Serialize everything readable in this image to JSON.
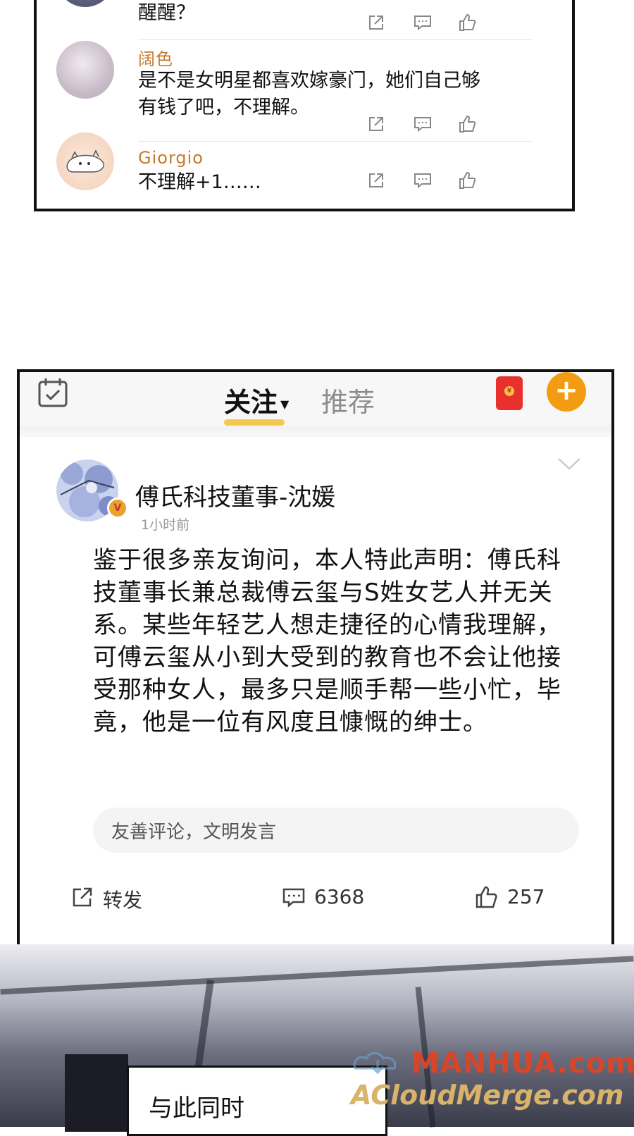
{
  "top_comments": [
    {
      "username": "",
      "text": "醒醒？"
    },
    {
      "username": "阔色",
      "text": "是不是女明星都喜欢嫁豪门，她们自己够有钱了吧，不理解。"
    },
    {
      "username": "Giorgio",
      "text": "不理解+1……"
    }
  ],
  "feed": {
    "tabs": {
      "follow": "关注",
      "recommend": "推荐"
    },
    "post": {
      "author": "傅氏科技董事-沈媛",
      "verified_badge": "V",
      "time": "1小时前",
      "body": "鉴于很多亲友询问，本人特此声明：傅氏科技董事长兼总裁傅云玺与S姓女艺人并无关系。某些年轻艺人想走捷径的心情我理解，可傅云玺从小到大受到的教育也不会让他接受那种女人，最多只是顺手帮一些小忙，毕竟，他是一位有风度且慷慨的绅士。",
      "comment_placeholder": "友善评论，文明发言",
      "actions": {
        "repost": "转发",
        "comments": "6368",
        "likes": "257"
      }
    }
  },
  "scene": {
    "narration": "与此同时",
    "watermark_line1": "MANHUA.com",
    "watermark_line2": "ACloudMerge.com"
  },
  "colors": {
    "username": "#c47a2a",
    "tab_underline": "#f2c94c",
    "plus_button": "#f39c12",
    "red_packet": "#e8302c"
  }
}
